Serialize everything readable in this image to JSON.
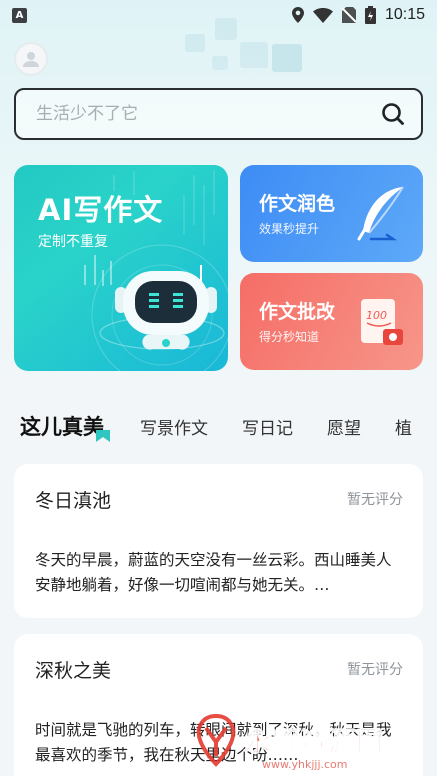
{
  "status_bar": {
    "app_icon_letter": "A",
    "time": "10:15"
  },
  "search": {
    "placeholder": "生活少不了它"
  },
  "cards": {
    "ai_write": {
      "title": "AI写作文",
      "subtitle": "定制不重复"
    },
    "polish": {
      "title": "作文润色",
      "subtitle": "效果秒提升"
    },
    "correct": {
      "title": "作文批改",
      "subtitle": "得分秒知道"
    }
  },
  "tabs": [
    "这儿真美",
    "写景作文",
    "写日记",
    "愿望",
    "植"
  ],
  "essays": [
    {
      "title": "冬日滇池",
      "rating": "暂无评分",
      "excerpt": "冬天的早晨，蔚蓝的天空没有一丝云彩。西山睡美人安静地躺着，好像一切喧闹都与她无关。…"
    },
    {
      "title": "深秋之美",
      "rating": "暂无评分",
      "excerpt": "时间就是飞驰的列车，转眼间就到了深秋，秋天是我最喜欢的季节，我在秋天里边个盼……"
    }
  ],
  "watermark": {
    "text": "永辉资源网",
    "url": "www.yhkjjj.com"
  },
  "colors": {
    "ai_card": "#22c9c4",
    "polish_card": "#3d8cf5",
    "correct_card": "#f56d66",
    "watermark": "#e43a2f"
  }
}
